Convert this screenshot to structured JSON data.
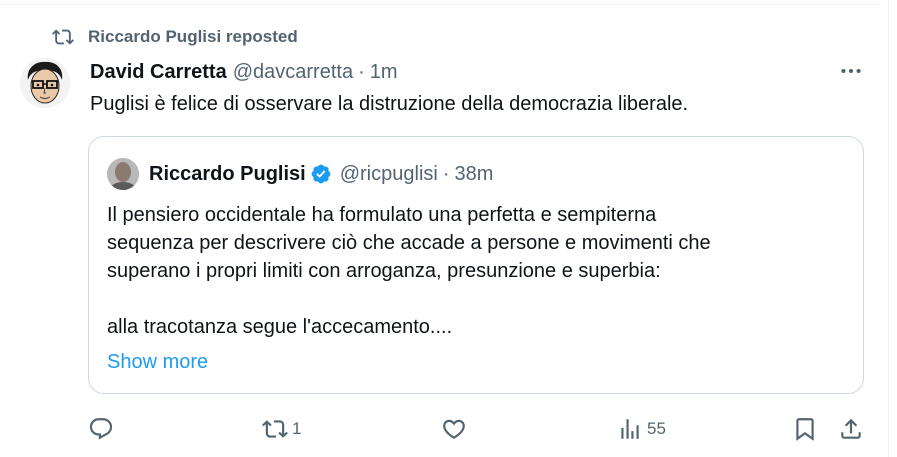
{
  "repost": {
    "icon": "repost-icon",
    "text": "Riccardo Puglisi reposted"
  },
  "post": {
    "author_name": "David Carretta",
    "author_handle": "@davcarretta",
    "separator": "·",
    "time": "1m",
    "text": "Puglisi è felice di osservare la distruzione della democrazia liberale.",
    "more_icon": "more-icon"
  },
  "quote": {
    "author_name": "Riccardo Puglisi",
    "verified_icon": "verified-badge-icon",
    "author_handle": "@ricpuglisi",
    "separator": "·",
    "time": "38m",
    "lines": [
      "Il pensiero occidentale ha formulato una perfetta e sempiterna",
      "sequenza per descrivere ciò che accade a persone e movimenti che",
      "superano i propri limiti con arroganza, presunzione e superbia:",
      "alla tracotanza segue l'accecamento...."
    ],
    "show_more": "Show more"
  },
  "actions": {
    "reply_count": "",
    "repost_count": "1",
    "like_count": "",
    "views_count": "55",
    "icons": [
      "reply-icon",
      "repost-icon",
      "like-icon",
      "views-icon",
      "bookmark-icon",
      "share-icon"
    ]
  },
  "colors": {
    "text": "#0f1419",
    "secondary": "#536471",
    "link": "#1d9bf0",
    "verified": "#1d9bf0",
    "border": "#cfd9de"
  }
}
